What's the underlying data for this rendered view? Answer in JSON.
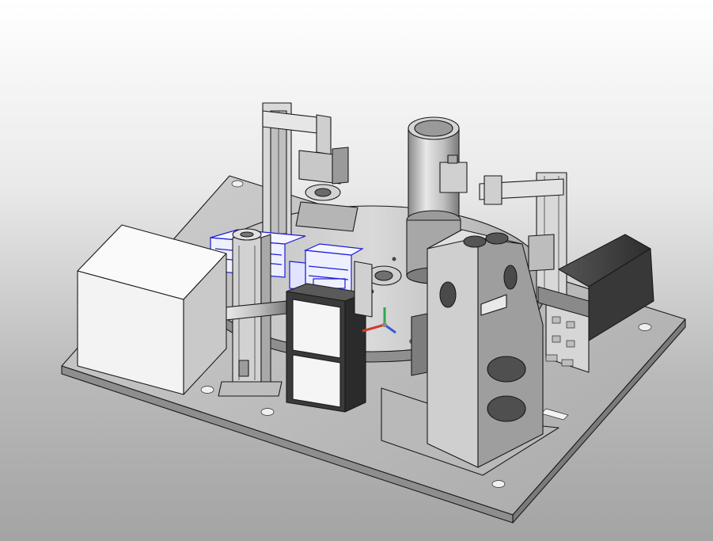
{
  "viewport": {
    "background_top": "#ffffff",
    "background_bottom": "#a4a4a4",
    "highlight_color": "#1d1dd6"
  },
  "triad": {
    "x_color": "#d23b2f",
    "y_color": "#2fa84a",
    "z_color": "#3a5ad8"
  }
}
